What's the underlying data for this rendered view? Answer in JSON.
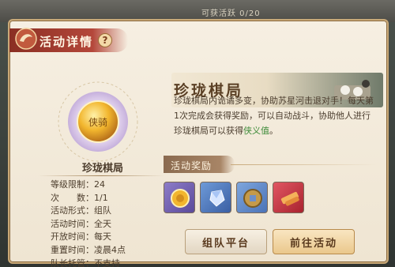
{
  "top_strip": {
    "text": "可获活跃 0/20"
  },
  "header": {
    "title": "活动详情",
    "help_symbol": "?"
  },
  "activity": {
    "name": "珍珑棋局",
    "medal_text": "侠骑",
    "info": [
      "等级限制：24",
      "次　　数：1/1",
      "活动形式：组队",
      "活动时间：全天",
      "开放时间：每天",
      "重置时间：凌晨4点",
      "队长托管：不支持"
    ]
  },
  "detail": {
    "title": "珍珑棋局",
    "description_part1": "珍珑棋局内诡谲多变，协助苏星河击退对手！每天第1次完成会获得奖励，可以自动战斗，协助他人进行珍珑棋局可以获得",
    "description_highlight": "侠义值",
    "description_end": "。"
  },
  "rewards": {
    "label": "活动奖励",
    "items": [
      {
        "icon": "gold-coin-icon",
        "color": "#6a5ca8"
      },
      {
        "icon": "crystal-gem-icon",
        "color": "#3d6fb8"
      },
      {
        "icon": "copper-coin-icon",
        "color": "#4f7fc4"
      },
      {
        "icon": "red-scroll-icon",
        "color": "#c2333f"
      }
    ]
  },
  "buttons": {
    "team": "组队平台",
    "go": "前往活动"
  }
}
